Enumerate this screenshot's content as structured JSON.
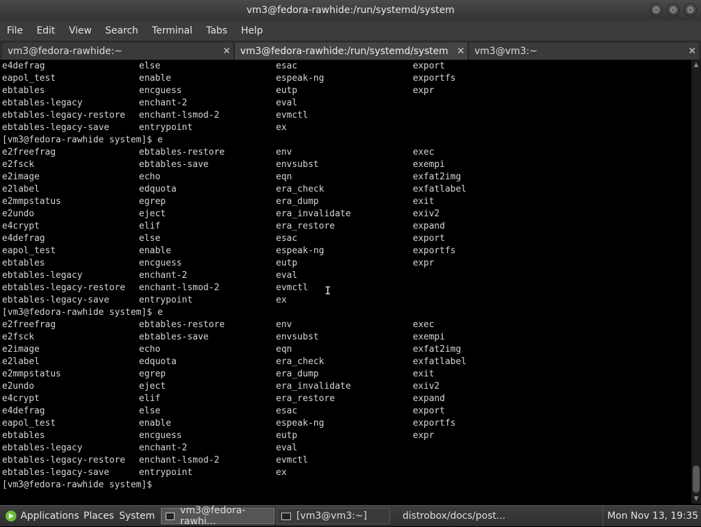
{
  "window": {
    "title": "vm3@fedora-rawhide:/run/systemd/system"
  },
  "menu": [
    "File",
    "Edit",
    "View",
    "Search",
    "Terminal",
    "Tabs",
    "Help"
  ],
  "tabs": [
    {
      "label": "vm3@fedora-rawhide:~"
    },
    {
      "label": "vm3@fedora-rawhide:/run/systemd/system"
    },
    {
      "label": "vm3@vm3:~"
    }
  ],
  "close_glyph": "✕",
  "terminal": {
    "lines": [
      [
        "e4defrag",
        "else",
        "esac",
        "export"
      ],
      [
        "eapol_test",
        "enable",
        "espeak-ng",
        "exportfs"
      ],
      [
        "ebtables",
        "encguess",
        "eutp",
        "expr"
      ],
      [
        "ebtables-legacy",
        "enchant-2",
        "eval",
        ""
      ],
      [
        "ebtables-legacy-restore",
        "enchant-lsmod-2",
        "evmctl",
        ""
      ],
      [
        "ebtables-legacy-save",
        "entrypoint",
        "ex",
        ""
      ],
      [
        "[vm3@fedora-rawhide system]$ e"
      ],
      [
        "e2freefrag",
        "ebtables-restore",
        "env",
        "exec"
      ],
      [
        "e2fsck",
        "ebtables-save",
        "envsubst",
        "exempi"
      ],
      [
        "e2image",
        "echo",
        "eqn",
        "exfat2img"
      ],
      [
        "e2label",
        "edquota",
        "era_check",
        "exfatlabel"
      ],
      [
        "e2mmpstatus",
        "egrep",
        "era_dump",
        "exit"
      ],
      [
        "e2undo",
        "eject",
        "era_invalidate",
        "exiv2"
      ],
      [
        "e4crypt",
        "elif",
        "era_restore",
        "expand"
      ],
      [
        "e4defrag",
        "else",
        "esac",
        "export"
      ],
      [
        "eapol_test",
        "enable",
        "espeak-ng",
        "exportfs"
      ],
      [
        "ebtables",
        "encguess",
        "eutp",
        "expr"
      ],
      [
        "ebtables-legacy",
        "enchant-2",
        "eval",
        ""
      ],
      [
        "ebtables-legacy-restore",
        "enchant-lsmod-2",
        "evmctl",
        ""
      ],
      [
        "ebtables-legacy-save",
        "entrypoint",
        "ex",
        ""
      ],
      [
        "[vm3@fedora-rawhide system]$ e"
      ],
      [
        "e2freefrag",
        "ebtables-restore",
        "env",
        "exec"
      ],
      [
        "e2fsck",
        "ebtables-save",
        "envsubst",
        "exempi"
      ],
      [
        "e2image",
        "echo",
        "eqn",
        "exfat2img"
      ],
      [
        "e2label",
        "edquota",
        "era_check",
        "exfatlabel"
      ],
      [
        "e2mmpstatus",
        "egrep",
        "era_dump",
        "exit"
      ],
      [
        "e2undo",
        "eject",
        "era_invalidate",
        "exiv2"
      ],
      [
        "e4crypt",
        "elif",
        "era_restore",
        "expand"
      ],
      [
        "e4defrag",
        "else",
        "esac",
        "export"
      ],
      [
        "eapol_test",
        "enable",
        "espeak-ng",
        "exportfs"
      ],
      [
        "ebtables",
        "encguess",
        "eutp",
        "expr"
      ],
      [
        "ebtables-legacy",
        "enchant-2",
        "eval",
        ""
      ],
      [
        "ebtables-legacy-restore",
        "enchant-lsmod-2",
        "evmctl",
        ""
      ],
      [
        "ebtables-legacy-save",
        "entrypoint",
        "ex",
        ""
      ],
      [
        "[vm3@fedora-rawhide system]$ "
      ]
    ]
  },
  "taskbar": {
    "applications": "Applications",
    "places": "Places",
    "system": "System",
    "tasks": [
      {
        "label": "vm3@fedora-rawhi...",
        "icon": "terminal-icon",
        "active": true
      },
      {
        "label": "[vm3@vm3:~]",
        "icon": "terminal-icon",
        "active": false
      },
      {
        "label": "distrobox/docs/post...",
        "icon": "firefox-icon",
        "active": false
      }
    ],
    "clock": "Mon Nov 13, 19:35"
  },
  "colors": {
    "terminal_bg": "#000000",
    "terminal_fg": "#d6d6d6",
    "chrome": "#3c3c3c"
  }
}
